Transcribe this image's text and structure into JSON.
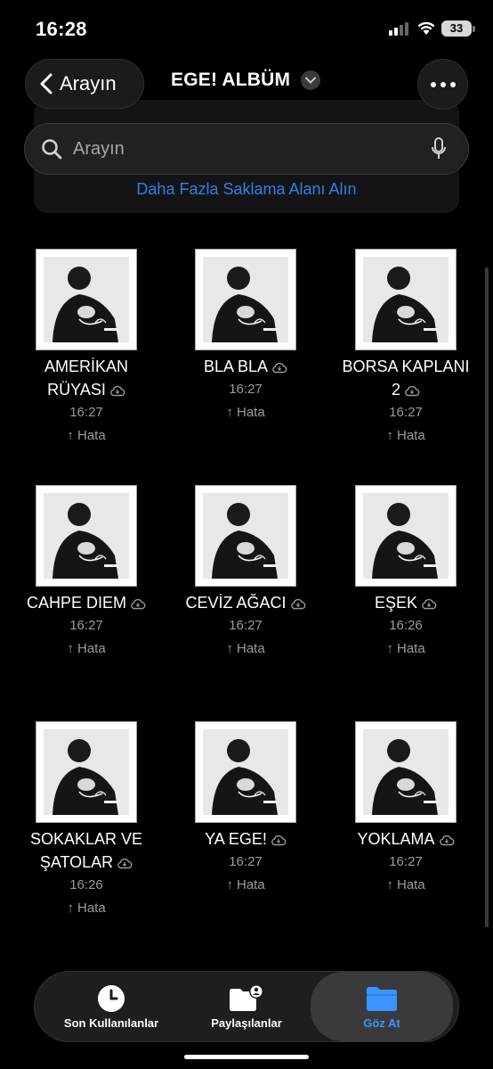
{
  "status": {
    "time": "16:28",
    "battery": "33"
  },
  "nav": {
    "back_label": "Arayın",
    "title": "EGE! ALBÜM"
  },
  "search": {
    "placeholder": "Arayın"
  },
  "banner": {
    "link": "Daha Fazla Saklama Alanı Alın"
  },
  "files": [
    {
      "name_lines": [
        "AMERİKAN",
        "RÜYASI"
      ],
      "time": "16:27",
      "status": "↑ Hata"
    },
    {
      "name_lines": [
        "BLA BLA"
      ],
      "time": "16:27",
      "status": "↑ Hata"
    },
    {
      "name_lines": [
        "BORSA KAPLANI",
        "2"
      ],
      "time": "16:27",
      "status": "↑ Hata"
    },
    {
      "name_lines": [
        "CAHPE DIEM"
      ],
      "time": "16:27",
      "status": "↑ Hata"
    },
    {
      "name_lines": [
        "CEVİZ AĞACI"
      ],
      "time": "16:27",
      "status": "↑ Hata"
    },
    {
      "name_lines": [
        "EŞEK"
      ],
      "time": "16:26",
      "status": "↑ Hata"
    },
    {
      "name_lines": [
        "SOKAKLAR VE",
        "ŞATOLAR"
      ],
      "time": "16:26",
      "status": "↑ Hata"
    },
    {
      "name_lines": [
        "YA EGE!"
      ],
      "time": "16:27",
      "status": "↑ Hata"
    },
    {
      "name_lines": [
        "YOKLAMA"
      ],
      "time": "16:27",
      "status": "↑ Hata"
    }
  ],
  "tabs": [
    {
      "label": "Son Kullanılanlar",
      "icon": "clock-icon",
      "active": false
    },
    {
      "label": "Paylaşılanlar",
      "icon": "shared-folder-icon",
      "active": false
    },
    {
      "label": "Göz At",
      "icon": "folder-icon",
      "active": true
    }
  ],
  "colors": {
    "accent": "#3c95ff",
    "link": "#2f7fe3",
    "background": "#000000"
  }
}
